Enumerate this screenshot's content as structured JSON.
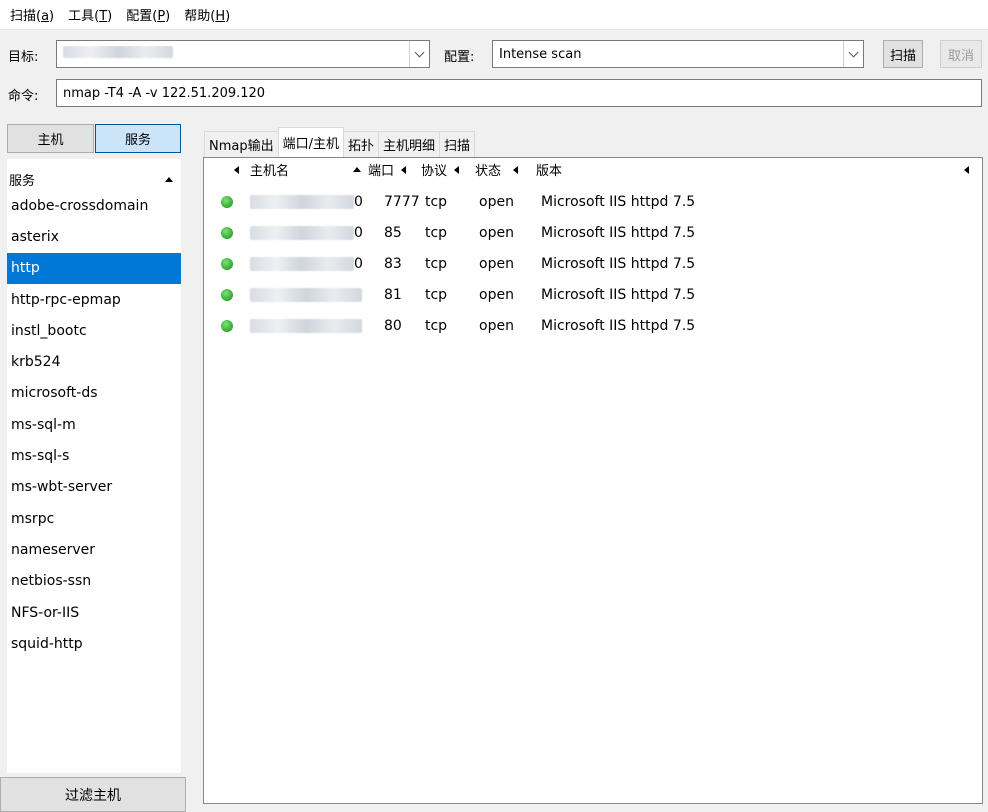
{
  "menu": [
    {
      "label": "扫描(",
      "key": "a",
      "tail": ")"
    },
    {
      "label": "工具(",
      "key": "T",
      "tail": ")"
    },
    {
      "label": "配置(",
      "key": "P",
      "tail": ")"
    },
    {
      "label": "帮助(",
      "key": "H",
      "tail": ")"
    }
  ],
  "target": {
    "label": "目标:",
    "value_blurred": true
  },
  "profile": {
    "label": "配置:",
    "value": "Intense scan"
  },
  "buttons": {
    "scan": "扫描",
    "cancel": "取消"
  },
  "command": {
    "label": "命令:",
    "value": "nmap -T4 -A -v 122.51.209.120"
  },
  "view_toggle": {
    "hosts": "主机",
    "services": "服务"
  },
  "services_panel": {
    "header": "服务",
    "items": [
      "adobe-crossdomain",
      "asterix",
      "http",
      "http-rpc-epmap",
      "instl_bootc",
      "krb524",
      "microsoft-ds",
      "ms-sql-m",
      "ms-sql-s",
      "ms-wbt-server",
      "msrpc",
      "nameserver",
      "netbios-ssn",
      "NFS-or-IIS",
      "squid-http"
    ],
    "selected": "http"
  },
  "tabs": [
    "Nmap输出",
    "端口/主机",
    "拓扑",
    "主机明细",
    "扫描"
  ],
  "active_tab": "端口/主机",
  "table": {
    "columns": [
      "主机名",
      "端口",
      "协议",
      "状态",
      "版本"
    ],
    "rows": [
      {
        "host_suffix": "0",
        "port": "7777",
        "protocol": "tcp",
        "state": "open",
        "version": "Microsoft IIS httpd 7.5"
      },
      {
        "host_suffix": "0",
        "port": "85",
        "protocol": "tcp",
        "state": "open",
        "version": "Microsoft IIS httpd 7.5"
      },
      {
        "host_suffix": "0",
        "port": "83",
        "protocol": "tcp",
        "state": "open",
        "version": "Microsoft IIS httpd 7.5"
      },
      {
        "host_suffix": "",
        "port": "81",
        "protocol": "tcp",
        "state": "open",
        "version": "Microsoft IIS httpd 7.5"
      },
      {
        "host_suffix": "",
        "port": "80",
        "protocol": "tcp",
        "state": "open",
        "version": "Microsoft IIS httpd 7.5"
      }
    ],
    "status_color": "#2fa82a"
  },
  "filter_button": "过滤主机"
}
